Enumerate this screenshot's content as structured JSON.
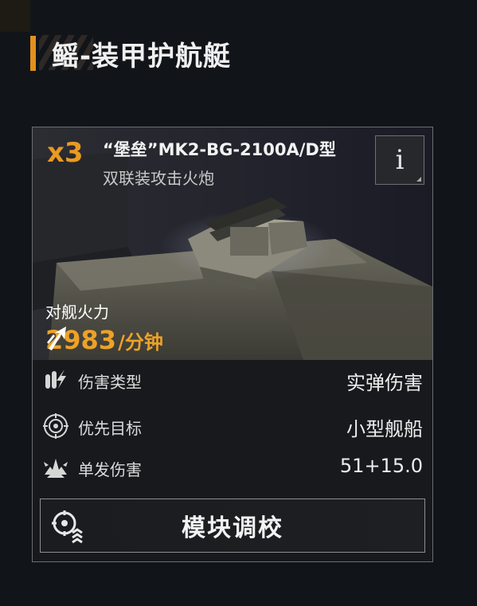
{
  "page": {
    "title": "鳐-装甲护航艇"
  },
  "weapon": {
    "count": "x3",
    "name": "“堡垒”MK2-BG-2100A/D型",
    "subtitle": "双联装攻击火炮",
    "info_label": "i"
  },
  "firepower": {
    "label": "对舰火力",
    "value": "2983",
    "unit": "/分钟"
  },
  "stats": [
    {
      "icon": "ammo-icon",
      "label": "伤害类型",
      "value": "实弹伤害"
    },
    {
      "icon": "target-icon",
      "label": "优先目标",
      "value": "小型舰船"
    },
    {
      "icon": "burst-icon",
      "label": "单发伤害",
      "value": "51+15.0"
    }
  ],
  "calibrate": {
    "label": "模块调校",
    "icon": "calibrate-icon"
  },
  "colors": {
    "accent": "#e99a21",
    "background": "#111519",
    "card_border": "#6a6e72"
  }
}
